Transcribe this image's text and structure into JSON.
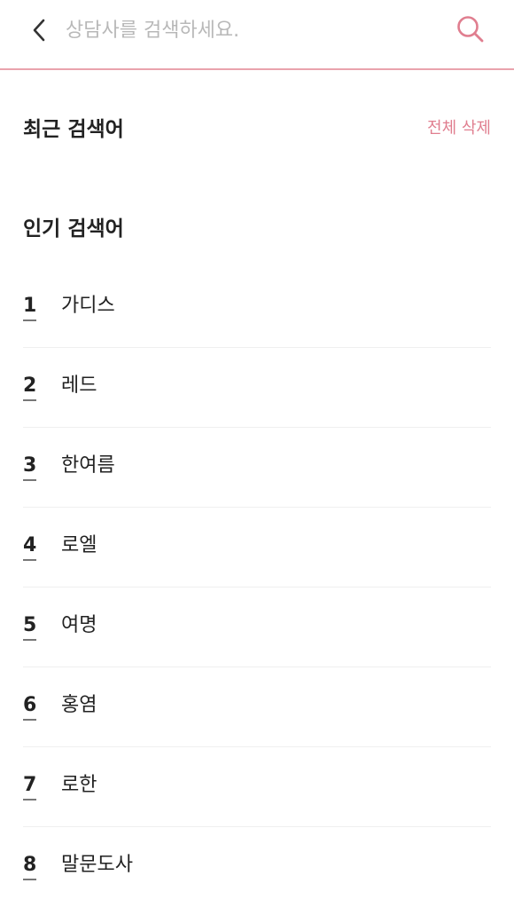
{
  "search": {
    "placeholder": "상담사를 검색하세요.",
    "value": ""
  },
  "recent": {
    "title": "최근 검색어",
    "delete_all_label": "전체 삭제"
  },
  "popular": {
    "title": "인기 검색어",
    "items": [
      {
        "rank": "1",
        "keyword": "가디스"
      },
      {
        "rank": "2",
        "keyword": "레드"
      },
      {
        "rank": "3",
        "keyword": "한여름"
      },
      {
        "rank": "4",
        "keyword": "로엘"
      },
      {
        "rank": "5",
        "keyword": "여명"
      },
      {
        "rank": "6",
        "keyword": "홍염"
      },
      {
        "rank": "7",
        "keyword": "로한"
      },
      {
        "rank": "8",
        "keyword": "말문도사"
      }
    ]
  },
  "colors": {
    "accent": "#e07e8f",
    "header_border": "#e9a3ad",
    "placeholder": "#b8b8b8",
    "divider": "#efefef"
  },
  "icons": {
    "back": "chevron-left-icon",
    "search": "search-icon"
  }
}
